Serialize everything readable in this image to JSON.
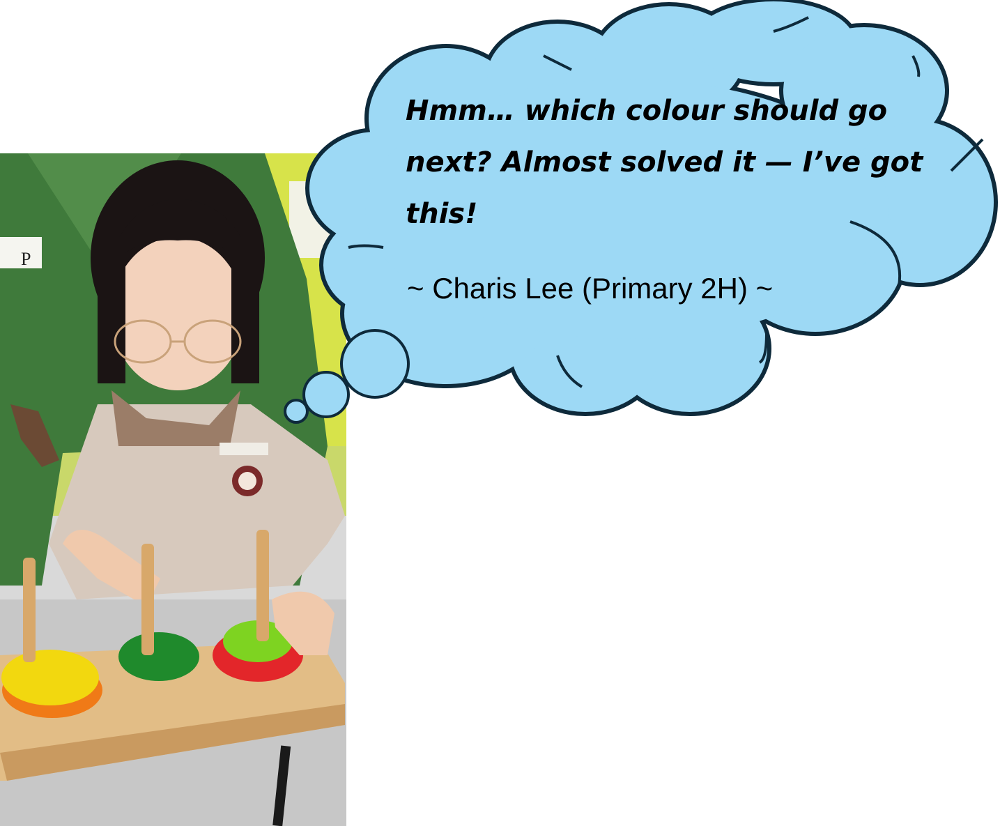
{
  "bubble": {
    "quote": "Hmm… which colour should go next? Almost solved it — I’ve got this!",
    "attribution": "~ Charis Lee (Primary 2H) ~",
    "fill_color": "#9dd9f5",
    "stroke_color": "#0e2a3b"
  },
  "photo": {
    "subject": "child-solving-tower-of-hanoi",
    "peg_colors": [
      "#d8a86a"
    ],
    "disc_colors": {
      "yellow": "#f2d80f",
      "orange": "#f07a17",
      "green": "#1f8a2c",
      "light_green": "#7ed321",
      "red": "#e3262a"
    }
  }
}
